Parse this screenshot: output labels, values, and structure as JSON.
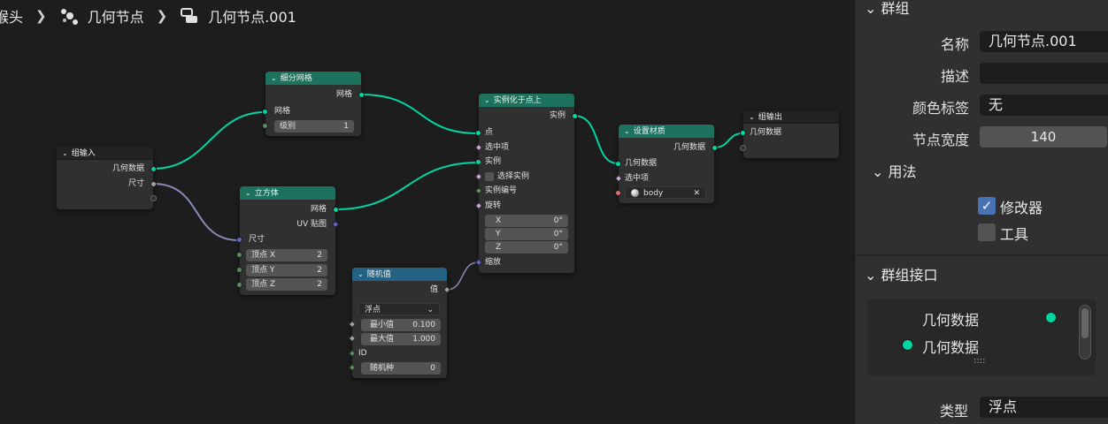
{
  "breadcrumb": {
    "object": "猴头",
    "modifier": "几何节点",
    "node_tree": "几何节点.001"
  },
  "nodes": {
    "subdivide_mesh": {
      "title": "细分网格",
      "out_mesh": "网格",
      "in_mesh": "网格",
      "level_label": "级别",
      "level_value": "1"
    },
    "group_input": {
      "title": "组输入",
      "out_geometry": "几何数据",
      "out_size": "尺寸"
    },
    "cube": {
      "title": "立方体",
      "out_mesh": "网格",
      "out_uv": "UV 贴图",
      "in_size": "尺寸",
      "vx_label": "顶点 X",
      "vx_value": "2",
      "vy_label": "顶点 Y",
      "vy_value": "2",
      "vz_label": "顶点 Z",
      "vz_value": "2"
    },
    "instance_on_points": {
      "title": "实例化于点上",
      "out_instances": "实例",
      "in_points": "点",
      "in_selection": "选中项",
      "in_instance": "实例",
      "in_pick_instance": "选择实例",
      "in_instance_index": "实例编号",
      "in_rotation": "旋转",
      "rx_label": "X",
      "rx_value": "0°",
      "ry_label": "Y",
      "ry_value": "0°",
      "rz_label": "Z",
      "rz_value": "0°",
      "in_scale": "缩放"
    },
    "random_value": {
      "title": "随机值",
      "out_value": "值",
      "type": "浮点",
      "min_label": "最小值",
      "min_value": "0.100",
      "max_label": "最大值",
      "max_value": "1.000",
      "in_id": "ID",
      "seed_label": "随机种",
      "seed_value": "0"
    },
    "set_material": {
      "title": "设置材质",
      "out_geometry": "几何数据",
      "in_geometry": "几何数据",
      "in_selection": "选中项",
      "material": "body"
    },
    "group_output": {
      "title": "组输出",
      "in_geometry": "几何数据"
    }
  },
  "panel": {
    "group_section": "群组",
    "name_label": "名称",
    "name_value": "几何节点.001",
    "desc_label": "描述",
    "desc_value": "",
    "color_tag_label": "颜色标签",
    "color_tag_value": "无",
    "node_width_label": "节点宽度",
    "node_width_value": "140",
    "usage_section": "用法",
    "modifier_label": "修改器",
    "modifier_checked": true,
    "tool_label": "工具",
    "tool_checked": false,
    "interface_section": "群组接口",
    "interface_output": "几何数据",
    "interface_input": "几何数据",
    "type_label": "类型",
    "type_value": "浮点"
  },
  "colors": {
    "geometry_socket": "#00d6a3",
    "geometry_header": "#1d725e",
    "texture_header": "#246283",
    "checkbox_on": "#4772b3"
  }
}
